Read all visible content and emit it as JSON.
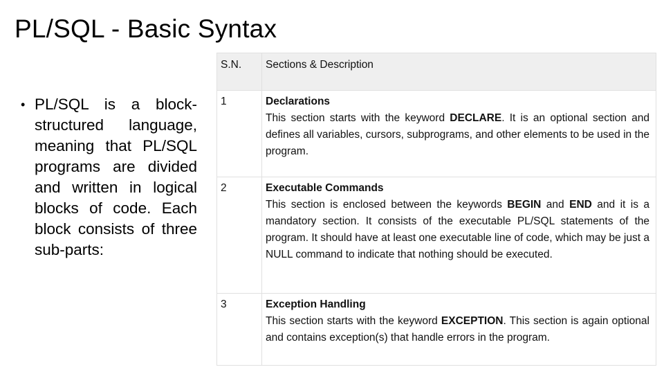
{
  "slide": {
    "title": "PL/SQL - Basic Syntax"
  },
  "bullet": {
    "marker": "•",
    "text": "PL/SQL is a block-structured language, meaning that PL/SQL programs are divided and written in logical blocks of code. Each block consists of three sub-parts:"
  },
  "table": {
    "headers": {
      "sn": "S.N.",
      "description": "Sections & Description"
    },
    "rows": [
      {
        "sn": "1",
        "title": "Declarations",
        "desc_before": "This section starts with the keyword ",
        "keyword1": "DECLARE",
        "desc_middle": ". It is an optional section and defines all variables, cursors, subprograms, and other elements to be used in the program.",
        "keyword2": "",
        "desc_after": ""
      },
      {
        "sn": "2",
        "title": "Executable Commands",
        "desc_before": "This section is enclosed between the keywords ",
        "keyword1": "BEGIN",
        "desc_middle": " and ",
        "keyword2": "END",
        "desc_after": " and it is a mandatory section. It consists of the executable PL/SQL statements of the program. It should have at least one executable line of code, which may be just a NULL command to indicate that nothing should be executed."
      },
      {
        "sn": "3",
        "title": "Exception Handling",
        "desc_before": "This section starts with the keyword ",
        "keyword1": "EXCEPTION",
        "desc_middle": ". This section is again optional and contains exception(s) that handle errors in the program.",
        "keyword2": "",
        "desc_after": ""
      }
    ]
  }
}
